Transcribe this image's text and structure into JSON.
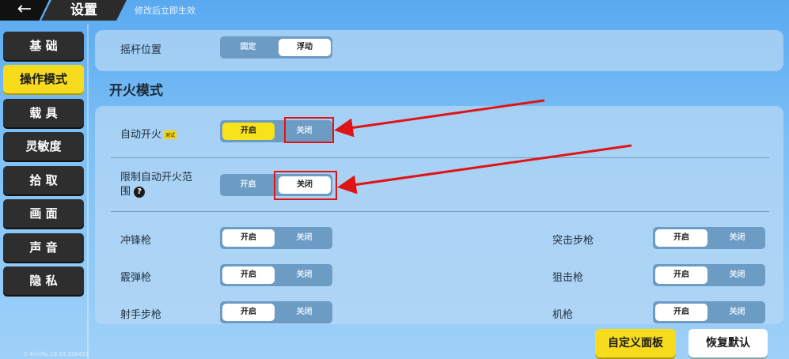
{
  "header": {
    "title": "设置",
    "subtitle": "修改后立即生效",
    "back_icon": "arrow-left-icon"
  },
  "sidebar": {
    "items": [
      {
        "label": "基 础"
      },
      {
        "label": "操作模式",
        "active": true
      },
      {
        "label": "载 具"
      },
      {
        "label": "灵敏度"
      },
      {
        "label": "拾 取"
      },
      {
        "label": "画 面"
      },
      {
        "label": "声 音"
      },
      {
        "label": "隐 私"
      }
    ],
    "version": "2.4imiRu.10.29.556493"
  },
  "joystick": {
    "label": "摇杆位置",
    "options": [
      "固定",
      "浮动"
    ],
    "selected": "浮动"
  },
  "fire_mode": {
    "title": "开火模式",
    "auto_fire": {
      "label": "自动开火",
      "badge": "测试",
      "on": "开启",
      "off": "关闭",
      "selected": "开启"
    },
    "limit_range": {
      "label_line1": "限制自动开火范",
      "label_line2": "围",
      "on": "开启",
      "off": "关闭",
      "selected": "关闭"
    },
    "weapons_left": [
      {
        "label": "冲锋枪",
        "on": "开启",
        "off": "关闭",
        "selected": "开启"
      },
      {
        "label": "霰弹枪",
        "on": "开启",
        "off": "关闭",
        "selected": "开启"
      },
      {
        "label": "射手步枪",
        "on": "开启",
        "off": "关闭",
        "selected": "开启"
      }
    ],
    "weapons_right": [
      {
        "label": "突击步枪",
        "on": "开启",
        "off": "关闭",
        "selected": "开启"
      },
      {
        "label": "狙击枪",
        "on": "开启",
        "off": "关闭",
        "selected": "开启"
      },
      {
        "label": "机枪",
        "on": "开启",
        "off": "关闭",
        "selected": "开启"
      }
    ]
  },
  "footer": {
    "custom_panel": "自定义面板",
    "restore_default": "恢复默认"
  },
  "colors": {
    "accent_yellow": "#f6dc1d",
    "annotation_red": "#e01414"
  }
}
